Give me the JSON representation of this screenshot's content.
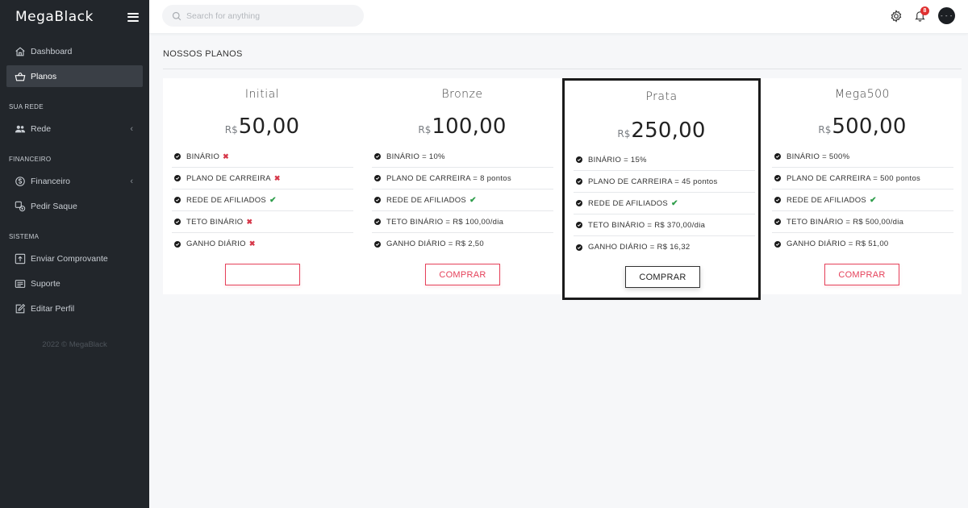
{
  "app": {
    "brand": "MegaBlack",
    "footer": "2022 © MegaBlack"
  },
  "sidebar": {
    "items": [
      {
        "label": "Dashboard",
        "icon": "home-icon"
      },
      {
        "label": "Planos",
        "icon": "basket-icon",
        "active": true
      }
    ],
    "sections": [
      {
        "label": "SUA REDE",
        "items": [
          {
            "label": "Rede",
            "icon": "users-icon",
            "has_children": true
          }
        ]
      },
      {
        "label": "FINANCEIRO",
        "items": [
          {
            "label": "Financeiro",
            "icon": "coin-icon",
            "has_children": true
          },
          {
            "label": "Pedir Saque",
            "icon": "withdraw-icon"
          }
        ]
      },
      {
        "label": "SISTEMA",
        "items": [
          {
            "label": "Enviar Comprovante",
            "icon": "upload-icon"
          },
          {
            "label": "Suporte",
            "icon": "support-icon"
          },
          {
            "label": "Editar Perfil",
            "icon": "edit-icon"
          }
        ]
      }
    ]
  },
  "topbar": {
    "search_placeholder": "Search for anything",
    "notifications_count": "8",
    "avatar_text": "- - -"
  },
  "page": {
    "title": "NOSSOS PLANOS"
  },
  "currency": "R$",
  "plans": [
    {
      "name": "Initial",
      "price": "50,00",
      "features": [
        {
          "label": "BINÁRIO",
          "mark": "x"
        },
        {
          "label": "PLANO DE CARREIRA",
          "mark": "x"
        },
        {
          "label": "REDE DE AFILIADOS",
          "mark": "check"
        },
        {
          "label": "TETO BINÁRIO",
          "mark": "x"
        },
        {
          "label": "GANHO DIÁRIO",
          "mark": "x"
        }
      ],
      "button": ""
    },
    {
      "name": "Bronze",
      "price": "100,00",
      "features": [
        {
          "label": "BINÁRIO = 10%"
        },
        {
          "label": "PLANO DE CARREIRA = 8 pontos"
        },
        {
          "label": "REDE DE AFILIADOS",
          "mark": "check"
        },
        {
          "label": "TETO BINÁRIO = R$ 100,00/dia"
        },
        {
          "label": "GANHO DIÁRIO = R$ 2,50"
        }
      ],
      "button": "COMPRAR"
    },
    {
      "name": "Prata",
      "price": "250,00",
      "featured": true,
      "features": [
        {
          "label": "BINÁRIO = 15%"
        },
        {
          "label": "PLANO DE CARREIRA = 45 pontos"
        },
        {
          "label": "REDE DE AFILIADOS",
          "mark": "check"
        },
        {
          "label": "TETO BINÁRIO = R$ 370,00/dia"
        },
        {
          "label": "GANHO DIÁRIO = R$ 16,32"
        }
      ],
      "button": "COMPRAR"
    },
    {
      "name": "Mega500",
      "price": "500,00",
      "features": [
        {
          "label": "BINÁRIO = 500%"
        },
        {
          "label": "PLANO DE CARREIRA = 500 pontos"
        },
        {
          "label": "REDE DE AFILIADOS",
          "mark": "check"
        },
        {
          "label": "TETO BINÁRIO = R$ 500,00/dia"
        },
        {
          "label": "GANHO DIÁRIO = R$ 51,00"
        }
      ],
      "button": "COMPRAR"
    }
  ],
  "colors": {
    "sidebar_bg": "#22262b",
    "accent_red": "#e5415a",
    "check_green": "#2e9d4a",
    "x_red": "#d6384a"
  }
}
